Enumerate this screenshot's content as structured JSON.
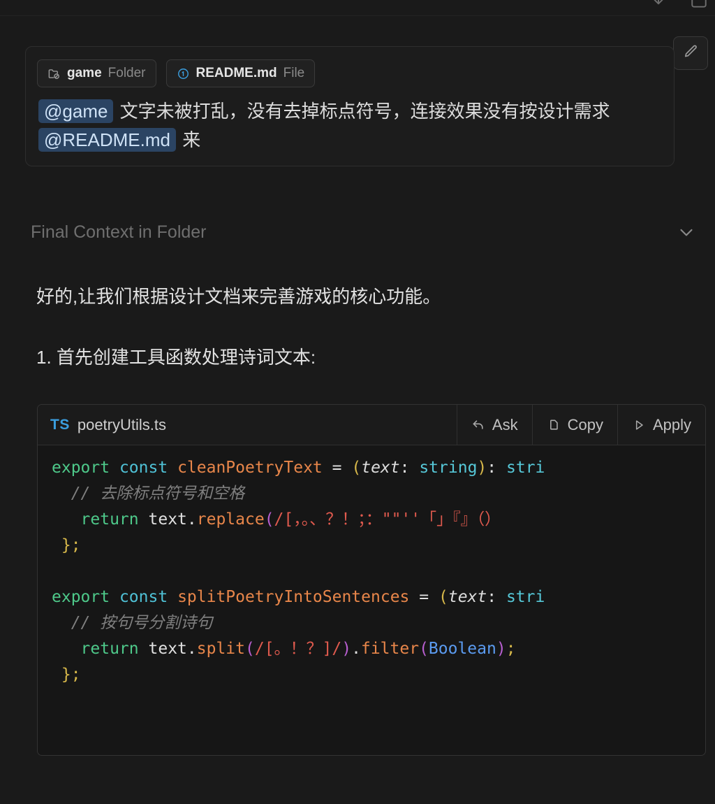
{
  "window": {
    "background": "#1a1a1a",
    "accent": "#3b9ede"
  },
  "top_toolbar": {
    "icons": [
      {
        "name": "download-icon",
        "glyph": "download"
      },
      {
        "name": "window-panel-icon",
        "glyph": "panel"
      }
    ]
  },
  "edit_button": {
    "name": "edit-message-button",
    "tooltip": "Edit"
  },
  "user_message": {
    "context_chips": [
      {
        "icon": "folder-icon",
        "name": "game",
        "kind": "Folder"
      },
      {
        "icon": "info-circle-icon",
        "name": "README.md",
        "kind": "File"
      }
    ],
    "text_parts": [
      {
        "type": "mention",
        "text": "@game"
      },
      {
        "type": "text",
        "text": " 文字未被打乱，没有去掉标点符号，连接效果没有按设计需求 "
      },
      {
        "type": "mention",
        "text": "@README.md"
      },
      {
        "type": "text",
        "text": " 来"
      }
    ]
  },
  "context_section": {
    "label": "Final Context in Folder",
    "expanded": false,
    "chevron": "chevron-down-icon"
  },
  "assistant_message": {
    "paragraphs": [
      "好的,让我们根据设计文档来完善游戏的核心功能。",
      "1. 首先创建工具函数处理诗词文本:"
    ]
  },
  "code_block": {
    "language_badge": "TS",
    "file_name": "poetryUtils.ts",
    "actions": [
      {
        "label": "Ask",
        "icon": "reply-arrow-icon"
      },
      {
        "label": "Copy",
        "icon": "copy-icon"
      },
      {
        "label": "Apply",
        "icon": "play-triangle-icon"
      }
    ],
    "lines": [
      {
        "id": "l1",
        "tokens": [
          {
            "c": "kw-export",
            "t": "export"
          },
          {
            "c": "op",
            "t": " "
          },
          {
            "c": "kw-const",
            "t": "const"
          },
          {
            "c": "op",
            "t": " "
          },
          {
            "c": "fn",
            "t": "cleanPoetryText"
          },
          {
            "c": "op",
            "t": " "
          },
          {
            "c": "plain",
            "t": "="
          },
          {
            "c": "op",
            "t": " "
          },
          {
            "c": "paren",
            "t": "("
          },
          {
            "c": "param",
            "t": "text"
          },
          {
            "c": "plain",
            "t": ":"
          },
          {
            "c": "op",
            "t": " "
          },
          {
            "c": "type",
            "t": "string"
          },
          {
            "c": "paren",
            "t": ")"
          },
          {
            "c": "plain",
            "t": ":"
          },
          {
            "c": "op",
            "t": " "
          },
          {
            "c": "type",
            "t": "stri"
          }
        ]
      },
      {
        "id": "l2",
        "tokens": [
          {
            "c": "op",
            "t": "  "
          },
          {
            "c": "comment",
            "t": "// 去除标点符号和空格"
          }
        ]
      },
      {
        "id": "l3",
        "tokens": [
          {
            "c": "op",
            "t": "   "
          },
          {
            "c": "kw-export",
            "t": "return"
          },
          {
            "c": "op",
            "t": " "
          },
          {
            "c": "plain",
            "t": "text"
          },
          {
            "c": "plain",
            "t": "."
          },
          {
            "c": "fn",
            "t": "replace"
          },
          {
            "c": "paren2",
            "t": "("
          },
          {
            "c": "regex",
            "t": "/[，。、？！；：\"\"''「」『』（）"
          }
        ]
      },
      {
        "id": "l4",
        "tokens": [
          {
            "c": "punc",
            "t": " };"
          }
        ]
      },
      {
        "id": "l5",
        "tokens": []
      },
      {
        "id": "l6",
        "tokens": [
          {
            "c": "kw-export",
            "t": "export"
          },
          {
            "c": "op",
            "t": " "
          },
          {
            "c": "kw-const",
            "t": "const"
          },
          {
            "c": "op",
            "t": " "
          },
          {
            "c": "fn",
            "t": "splitPoetryIntoSentences"
          },
          {
            "c": "op",
            "t": " "
          },
          {
            "c": "plain",
            "t": "="
          },
          {
            "c": "op",
            "t": " "
          },
          {
            "c": "paren",
            "t": "("
          },
          {
            "c": "param",
            "t": "text"
          },
          {
            "c": "plain",
            "t": ":"
          },
          {
            "c": "op",
            "t": " "
          },
          {
            "c": "type",
            "t": "stri"
          }
        ]
      },
      {
        "id": "l7",
        "tokens": [
          {
            "c": "op",
            "t": "  "
          },
          {
            "c": "comment",
            "t": "// 按句号分割诗句"
          }
        ]
      },
      {
        "id": "l8",
        "tokens": [
          {
            "c": "op",
            "t": "   "
          },
          {
            "c": "kw-export",
            "t": "return"
          },
          {
            "c": "op",
            "t": " "
          },
          {
            "c": "plain",
            "t": "text"
          },
          {
            "c": "plain",
            "t": "."
          },
          {
            "c": "fn",
            "t": "split"
          },
          {
            "c": "paren2",
            "t": "("
          },
          {
            "c": "regex",
            "t": "/[。！？]/"
          },
          {
            "c": "paren2",
            "t": ")"
          },
          {
            "c": "plain",
            "t": "."
          },
          {
            "c": "fn",
            "t": "filter"
          },
          {
            "c": "paren2",
            "t": "("
          },
          {
            "c": "cls",
            "t": "Boolean"
          },
          {
            "c": "paren2",
            "t": ")"
          },
          {
            "c": "punc",
            "t": ";"
          }
        ]
      },
      {
        "id": "l9",
        "tokens": [
          {
            "c": "punc",
            "t": " };"
          }
        ]
      }
    ]
  }
}
